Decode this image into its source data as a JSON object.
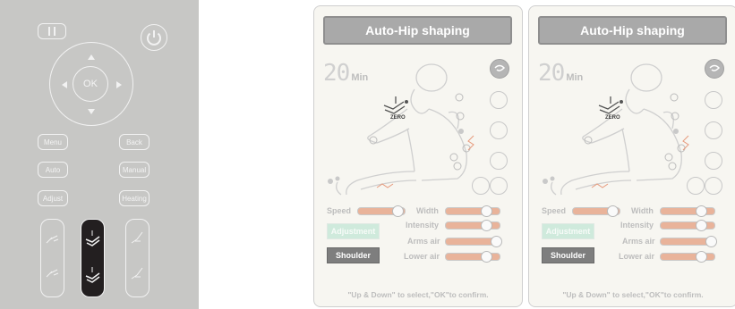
{
  "remote": {
    "ok_label": "OK",
    "buttons": {
      "menu": "Menu",
      "back": "Back",
      "auto": "Auto",
      "manual": "Manual",
      "adjust": "Adjust",
      "heating": "Heating"
    },
    "icons": [
      "pause-icon",
      "power-icon",
      "arrow-up-icon",
      "arrow-down-icon",
      "arrow-left-icon",
      "arrow-right-icon",
      "recline-icon",
      "zero-gravity-icon"
    ]
  },
  "screens": [
    {
      "title": "Auto-Hip shaping",
      "timer_value": "20",
      "timer_unit": "Min",
      "zero_label": "ZERO",
      "sliders": {
        "speed": {
          "label": "Speed",
          "level": 0.85
        },
        "width": {
          "label": "Width",
          "level": 0.75
        },
        "intensity": {
          "label": "Intensity",
          "level": 0.75
        },
        "arms_air": {
          "label": "Arms air",
          "level": 0.98
        },
        "lower_air": {
          "label": "Lower air",
          "level": 0.75
        }
      },
      "adjustment_label": "Adjustment",
      "shoulder_label": "Shoulder",
      "hint": "\"Up & Down\" to select,\"OK\"to confirm."
    },
    {
      "title": "Auto-Hip shaping",
      "timer_value": "20",
      "timer_unit": "Min",
      "zero_label": "ZERO",
      "sliders": {
        "speed": {
          "label": "Speed",
          "level": 0.85
        },
        "width": {
          "label": "Width",
          "level": 0.75
        },
        "intensity": {
          "label": "Intensity",
          "level": 0.75
        },
        "arms_air": {
          "label": "Arms air",
          "level": 0.98
        },
        "lower_air": {
          "label": "Lower air",
          "level": 0.75
        }
      },
      "adjustment_label": "Adjustment",
      "shoulder_label": "Shoulder",
      "hint": "\"Up & Down\" to select,\"OK\"to confirm."
    }
  ],
  "colors": {
    "remote_body": "#c7c7c5",
    "screen_bg": "#f7f6f1",
    "title_bar": "#a9a9a9",
    "slider_fill": "#e9b39a",
    "adjustment_bg": "#cfeadc",
    "shoulder_bg": "#7e7e7e"
  }
}
